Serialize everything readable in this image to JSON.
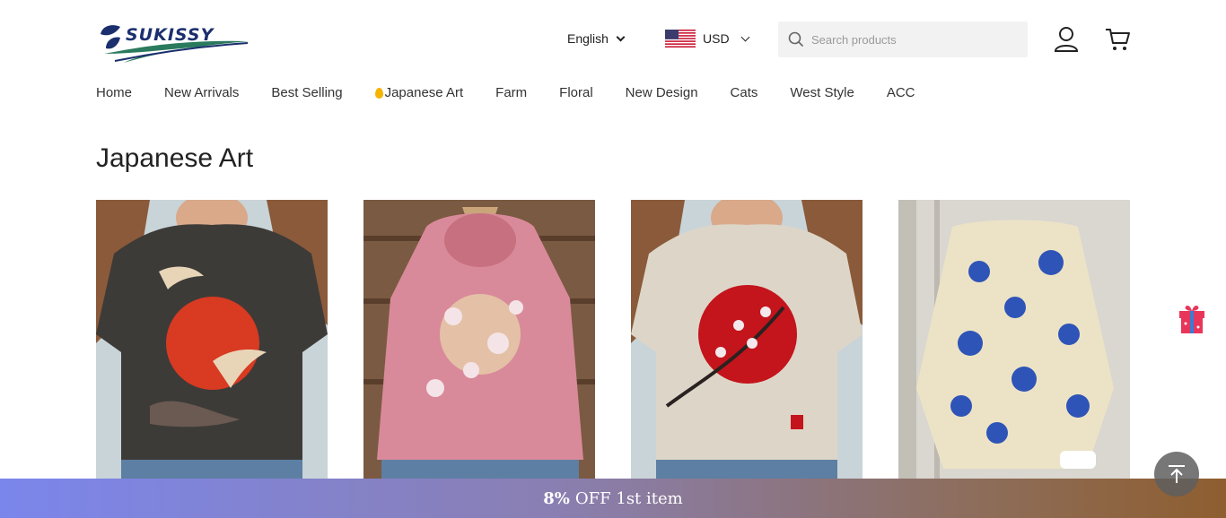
{
  "header": {
    "logo_text": "SUKISSY",
    "language": {
      "selected": "English",
      "icon": "chevron-down-icon"
    },
    "currency": {
      "selected": "USD",
      "flag": "us-flag-icon",
      "icon": "chevron-down-icon"
    },
    "search": {
      "placeholder": "Search products",
      "value": "",
      "icon": "search-icon"
    },
    "account_icon": "user-icon",
    "cart_icon": "cart-icon"
  },
  "nav": {
    "items": [
      {
        "label": "Home"
      },
      {
        "label": "New Arrivals"
      },
      {
        "label": "Best Selling"
      },
      {
        "label": "Japanese Art",
        "icon": "hot-flame-icon"
      },
      {
        "label": "Farm"
      },
      {
        "label": "Floral"
      },
      {
        "label": "New Design"
      },
      {
        "label": "Cats"
      },
      {
        "label": "West Style"
      },
      {
        "label": "ACC"
      }
    ]
  },
  "page": {
    "title": "Japanese Art"
  },
  "products": [
    {
      "image": "dark-tshirt-red-sun-cranes"
    },
    {
      "image": "pink-hoodie-cherry-blossom"
    },
    {
      "image": "beige-tshirt-red-sun-blossom"
    },
    {
      "image": "cream-shirt-blue-flowers"
    }
  ],
  "promo": {
    "bold": "8%",
    "text": "OFF 1st item"
  },
  "floating": {
    "gift_icon": "gift-box-icon",
    "top_icon": "back-to-top-icon"
  },
  "colors": {
    "promo_start": "#7b86ec",
    "promo_end": "#8e5e2f",
    "brand_navy": "#1b2f6e",
    "brand_green": "#2a7a5e"
  }
}
